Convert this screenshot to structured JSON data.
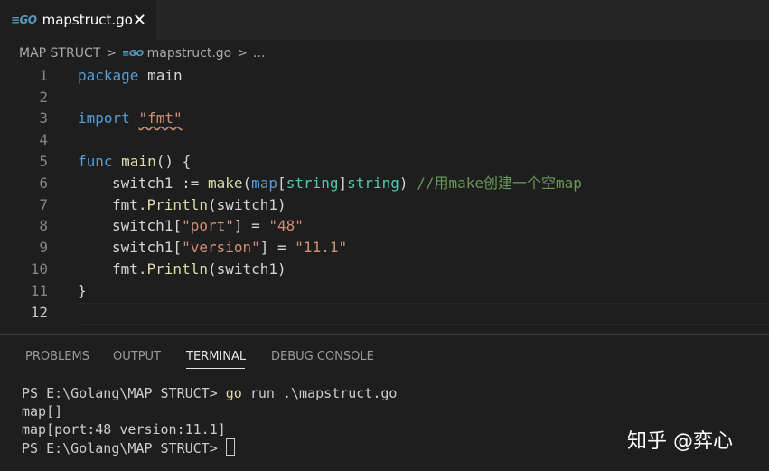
{
  "tab": {
    "icon": "go-file-icon",
    "label": "mapstruct.go",
    "close": "✕"
  },
  "breadcrumb": {
    "folder": "MAP STRUCT",
    "separator": ">",
    "file": "mapstruct.go",
    "ellipsis": "..."
  },
  "editor": {
    "line_numbers": [
      "1",
      "2",
      "3",
      "4",
      "5",
      "6",
      "7",
      "8",
      "9",
      "10",
      "11",
      "12"
    ],
    "lines": {
      "l1": {
        "kw": "package",
        "rest": " main"
      },
      "l3": {
        "kw": "import",
        "sp": " ",
        "str": "\"fmt\""
      },
      "l5": {
        "kw": "func",
        "fn": " main",
        "rest": "() {"
      },
      "l6": {
        "a": "switch1 := ",
        "make": "make",
        "paren": "(",
        "map": "map",
        "br1": "[",
        "string1": "string",
        "br2": "]",
        "string2": "string",
        "close": ")",
        "comment": " //用make创建一个空map"
      },
      "l7": {
        "pkg": "fmt.",
        "fn": "Println",
        "rest": "(switch1)"
      },
      "l8": {
        "a": "switch1[",
        "key": "\"port\"",
        "b": "] = ",
        "val": "\"48\""
      },
      "l9": {
        "a": "switch1[",
        "key": "\"version\"",
        "b": "] = ",
        "val": "\"11.1\""
      },
      "l10": {
        "pkg": "fmt.",
        "fn": "Println",
        "rest": "(switch1)"
      },
      "l11": {
        "rest": "}"
      }
    },
    "active_line": "12"
  },
  "panel": {
    "tabs": [
      "PROBLEMS",
      "OUTPUT",
      "TERMINAL",
      "DEBUG CONSOLE"
    ],
    "active_tab": "TERMINAL"
  },
  "terminal": {
    "line1_prompt": "PS E:\\Golang\\MAP STRUCT> ",
    "line1_go": "go",
    "line1_rest": " run .\\mapstruct.go",
    "line2": "map[]",
    "line3": "map[port:48 version:11.1]",
    "line4_prompt": "PS E:\\Golang\\MAP STRUCT> "
  },
  "watermark": "知乎 @弈心",
  "colors": {
    "background": "#1e1e1e",
    "keyword": "#569cd6",
    "function": "#dcdcaa",
    "string": "#ce9178",
    "type": "#4ec9b0",
    "comment": "#6a9955"
  }
}
